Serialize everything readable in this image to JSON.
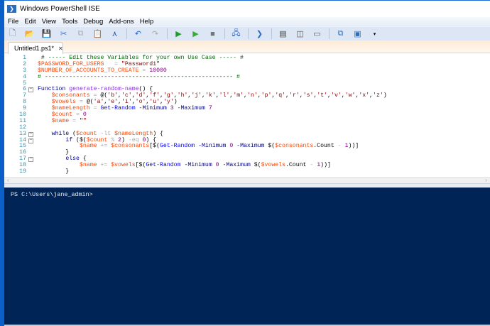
{
  "window": {
    "title": "Windows PowerShell ISE"
  },
  "menu": [
    "File",
    "Edit",
    "View",
    "Tools",
    "Debug",
    "Add-ons",
    "Help"
  ],
  "toolbar": [
    {
      "name": "new-icon",
      "glyph": "🗋",
      "color": "#666"
    },
    {
      "name": "open-icon",
      "glyph": "📂",
      "color": "#d9a520"
    },
    {
      "name": "save-icon",
      "glyph": "💾",
      "color": "#2b5ea8"
    },
    {
      "name": "cut-icon",
      "glyph": "✂",
      "color": "#3b6fc2"
    },
    {
      "name": "copy-icon",
      "glyph": "⧉",
      "color": "#aaa"
    },
    {
      "name": "paste-icon",
      "glyph": "📋",
      "color": "#333"
    },
    {
      "name": "clear-console-icon",
      "glyph": "⋏",
      "color": "#1e4e9a"
    },
    {
      "sep": true
    },
    {
      "name": "undo-icon",
      "glyph": "↶",
      "color": "#2b63c0"
    },
    {
      "name": "redo-icon",
      "glyph": "↷",
      "color": "#aaa"
    },
    {
      "sep": true
    },
    {
      "name": "run-script-icon",
      "glyph": "▶",
      "color": "#1f9d2a"
    },
    {
      "name": "run-selection-icon",
      "glyph": "▶",
      "color": "#3aaa3a"
    },
    {
      "name": "stop-icon",
      "glyph": "■",
      "color": "#777"
    },
    {
      "sep": true
    },
    {
      "name": "remote-powershell-icon",
      "glyph": "🖧",
      "color": "#2b63c0"
    },
    {
      "sep": true
    },
    {
      "name": "start-powershell-icon",
      "glyph": "❯",
      "color": "#2a6cc0"
    },
    {
      "sep": true
    },
    {
      "name": "show-script-pane-top-icon",
      "glyph": "▤",
      "color": "#444"
    },
    {
      "name": "show-script-pane-right-icon",
      "glyph": "◫",
      "color": "#555"
    },
    {
      "name": "show-script-pane-max-icon",
      "glyph": "▭",
      "color": "#555"
    },
    {
      "sep": true
    },
    {
      "name": "show-command-window-icon",
      "glyph": "⧉",
      "color": "#2a6cc0"
    },
    {
      "name": "show-command-addon-icon",
      "glyph": "▣",
      "color": "#2a6cc0"
    }
  ],
  "tab": {
    "label": "Untitled1.ps1*",
    "close": "✕"
  },
  "editor": {
    "lines": [
      [
        [
          "comment",
          " # ----- Edit these Variables for your own Use Case ----- #"
        ]
      ],
      [
        [
          "var",
          "$PASSWORD_FOR_USERS"
        ],
        [
          "plain",
          "   "
        ],
        [
          "op",
          "="
        ],
        [
          "plain",
          " "
        ],
        [
          "str",
          "\"Password1\""
        ]
      ],
      [
        [
          "var",
          "$NUMBER_OF_ACCOUNTS_TO_CREATE"
        ],
        [
          "plain",
          " "
        ],
        [
          "op",
          "="
        ],
        [
          "plain",
          " "
        ],
        [
          "num",
          "10000"
        ]
      ],
      [
        [
          "comment",
          "# ------------------------------------------------------ #"
        ]
      ],
      [],
      [
        [
          "kw",
          "Function"
        ],
        [
          "plain",
          " "
        ],
        [
          "fn",
          "generate-random-name"
        ],
        [
          "plain",
          "() {"
        ]
      ],
      [
        [
          "plain",
          "    "
        ],
        [
          "var",
          "$consonants"
        ],
        [
          "plain",
          " "
        ],
        [
          "op",
          "="
        ],
        [
          "plain",
          " @("
        ],
        [
          "str",
          "'b'"
        ],
        [
          "plain",
          ","
        ],
        [
          "str",
          "'c'"
        ],
        [
          "plain",
          ","
        ],
        [
          "str",
          "'d'"
        ],
        [
          "plain",
          ","
        ],
        [
          "str",
          "'f'"
        ],
        [
          "plain",
          ","
        ],
        [
          "str",
          "'g'"
        ],
        [
          "plain",
          ","
        ],
        [
          "str",
          "'h'"
        ],
        [
          "plain",
          ","
        ],
        [
          "str",
          "'j'"
        ],
        [
          "plain",
          ","
        ],
        [
          "str",
          "'k'"
        ],
        [
          "plain",
          ","
        ],
        [
          "str",
          "'l'"
        ],
        [
          "plain",
          ","
        ],
        [
          "str",
          "'m'"
        ],
        [
          "plain",
          ","
        ],
        [
          "str",
          "'n'"
        ],
        [
          "plain",
          ","
        ],
        [
          "str",
          "'p'"
        ],
        [
          "plain",
          ","
        ],
        [
          "str",
          "'q'"
        ],
        [
          "plain",
          ","
        ],
        [
          "str",
          "'r'"
        ],
        [
          "plain",
          ","
        ],
        [
          "str",
          "'s'"
        ],
        [
          "plain",
          ","
        ],
        [
          "str",
          "'t'"
        ],
        [
          "plain",
          ","
        ],
        [
          "str",
          "'v'"
        ],
        [
          "plain",
          ","
        ],
        [
          "str",
          "'w'"
        ],
        [
          "plain",
          ","
        ],
        [
          "str",
          "'x'"
        ],
        [
          "plain",
          ","
        ],
        [
          "str",
          "'z'"
        ],
        [
          "plain",
          ")"
        ]
      ],
      [
        [
          "plain",
          "    "
        ],
        [
          "var",
          "$vowels"
        ],
        [
          "plain",
          " "
        ],
        [
          "op",
          "="
        ],
        [
          "plain",
          " @("
        ],
        [
          "str",
          "'a'"
        ],
        [
          "plain",
          ","
        ],
        [
          "str",
          "'e'"
        ],
        [
          "plain",
          ","
        ],
        [
          "str",
          "'i'"
        ],
        [
          "plain",
          ","
        ],
        [
          "str",
          "'o'"
        ],
        [
          "plain",
          ","
        ],
        [
          "str",
          "'u'"
        ],
        [
          "plain",
          ","
        ],
        [
          "str",
          "'y'"
        ],
        [
          "plain",
          ")"
        ]
      ],
      [
        [
          "plain",
          "    "
        ],
        [
          "var",
          "$nameLength"
        ],
        [
          "plain",
          " "
        ],
        [
          "op",
          "="
        ],
        [
          "plain",
          " "
        ],
        [
          "cmd",
          "Get-Random"
        ],
        [
          "plain",
          " "
        ],
        [
          "param",
          "-Minimum"
        ],
        [
          "plain",
          " "
        ],
        [
          "num",
          "3"
        ],
        [
          "plain",
          " "
        ],
        [
          "param",
          "-Maximum"
        ],
        [
          "plain",
          " "
        ],
        [
          "num",
          "7"
        ]
      ],
      [
        [
          "plain",
          "    "
        ],
        [
          "var",
          "$count"
        ],
        [
          "plain",
          " "
        ],
        [
          "op",
          "="
        ],
        [
          "plain",
          " "
        ],
        [
          "num",
          "0"
        ]
      ],
      [
        [
          "plain",
          "    "
        ],
        [
          "var",
          "$name"
        ],
        [
          "plain",
          " "
        ],
        [
          "op",
          "="
        ],
        [
          "plain",
          " "
        ],
        [
          "str",
          "\"\""
        ]
      ],
      [],
      [
        [
          "plain",
          "    "
        ],
        [
          "kw",
          "while"
        ],
        [
          "plain",
          " ("
        ],
        [
          "var",
          "$count"
        ],
        [
          "plain",
          " "
        ],
        [
          "op",
          "-lt"
        ],
        [
          "plain",
          " "
        ],
        [
          "var",
          "$nameLength"
        ],
        [
          "plain",
          ") {"
        ]
      ],
      [
        [
          "plain",
          "        "
        ],
        [
          "kw",
          "if"
        ],
        [
          "plain",
          " ($("
        ],
        [
          "var",
          "$count"
        ],
        [
          "plain",
          " "
        ],
        [
          "op",
          "%"
        ],
        [
          "plain",
          " "
        ],
        [
          "num",
          "2"
        ],
        [
          "plain",
          ") "
        ],
        [
          "op",
          "-eq"
        ],
        [
          "plain",
          " "
        ],
        [
          "num",
          "0"
        ],
        [
          "plain",
          ") {"
        ]
      ],
      [
        [
          "plain",
          "            "
        ],
        [
          "var",
          "$name"
        ],
        [
          "plain",
          " "
        ],
        [
          "op",
          "+="
        ],
        [
          "plain",
          " "
        ],
        [
          "var",
          "$consonants"
        ],
        [
          "plain",
          "[$("
        ],
        [
          "cmd",
          "Get-Random"
        ],
        [
          "plain",
          " "
        ],
        [
          "param",
          "-Minimum"
        ],
        [
          "plain",
          " "
        ],
        [
          "num",
          "0"
        ],
        [
          "plain",
          " "
        ],
        [
          "param",
          "-Maximum"
        ],
        [
          "plain",
          " $("
        ],
        [
          "var",
          "$consonants"
        ],
        [
          "plain",
          ".Count "
        ],
        [
          "op",
          "-"
        ],
        [
          "plain",
          " "
        ],
        [
          "num",
          "1"
        ],
        [
          "plain",
          "))]"
        ]
      ],
      [
        [
          "plain",
          "        }"
        ]
      ],
      [
        [
          "plain",
          "        "
        ],
        [
          "kw",
          "else"
        ],
        [
          "plain",
          " {"
        ]
      ],
      [
        [
          "plain",
          "            "
        ],
        [
          "var",
          "$name"
        ],
        [
          "plain",
          " "
        ],
        [
          "op",
          "+="
        ],
        [
          "plain",
          " "
        ],
        [
          "var",
          "$vowels"
        ],
        [
          "plain",
          "[$("
        ],
        [
          "cmd",
          "Get-Random"
        ],
        [
          "plain",
          " "
        ],
        [
          "param",
          "-Minimum"
        ],
        [
          "plain",
          " "
        ],
        [
          "num",
          "0"
        ],
        [
          "plain",
          " "
        ],
        [
          "param",
          "-Maximum"
        ],
        [
          "plain",
          " $("
        ],
        [
          "var",
          "$vowels"
        ],
        [
          "plain",
          ".Count "
        ],
        [
          "op",
          "-"
        ],
        [
          "plain",
          " "
        ],
        [
          "num",
          "1"
        ],
        [
          "plain",
          "))]"
        ]
      ],
      [
        [
          "plain",
          "        }"
        ]
      ]
    ],
    "folds": {
      "6": "−",
      "13": "−",
      "14": "−",
      "17": "−"
    }
  },
  "console": {
    "prompt": "PS C:\\Users\\jane_admin>"
  }
}
